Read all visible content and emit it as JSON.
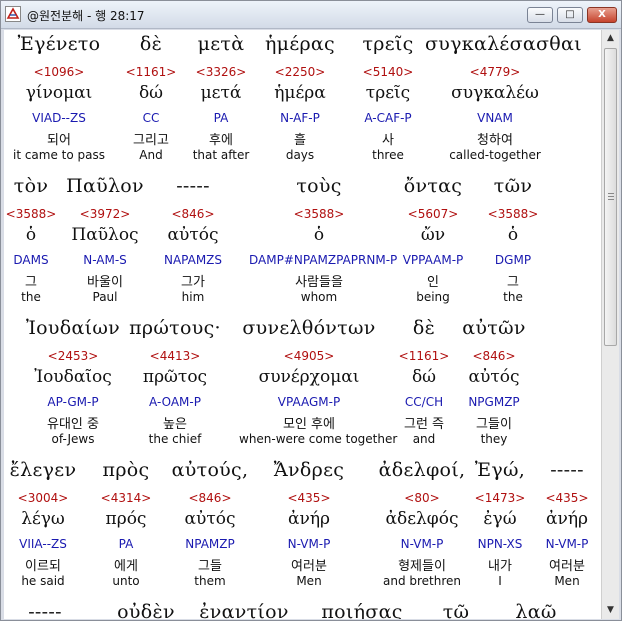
{
  "window": {
    "title": "@원전분해 - 행 28:17",
    "min_label": "—",
    "max_label": "□",
    "close_label": "X"
  },
  "rows": [
    {
      "words": [
        {
          "greek": "Ἐγένετο",
          "strong": "<1096>",
          "lemma": "γίνομαι",
          "parse": "VIAD--ZS",
          "korean": "되어",
          "english": "it came to pass"
        },
        {
          "greek": "δὲ",
          "strong": "<1161>",
          "lemma": "δώ",
          "parse": "CC",
          "korean": "그리고",
          "english": "And"
        },
        {
          "greek": "μετὰ",
          "strong": "<3326>",
          "lemma": "μετά",
          "parse": "PA",
          "korean": "후에",
          "english": "that after"
        },
        {
          "greek": "ἡμέρας",
          "strong": "<2250>",
          "lemma": "ἡμέρα",
          "parse": "N-AF-P",
          "korean": "흘",
          "english": "days"
        },
        {
          "greek": "τρεῖς",
          "strong": "<5140>",
          "lemma": "τρεῖς",
          "parse": "A-CAF-P",
          "korean": "사",
          "english": "three"
        },
        {
          "greek": "συγκαλέσασθαι",
          "strong": "<4779>",
          "lemma": "συγκαλέω",
          "parse": "VNAM",
          "korean": "청하여",
          "english": "called-together"
        }
      ]
    },
    {
      "words": [
        {
          "greek": "τὸν",
          "strong": "<3588>",
          "lemma": "ὁ",
          "parse": "DAMS",
          "korean": "그",
          "english": "the"
        },
        {
          "greek": "Παῦλον",
          "strong": "<3972>",
          "lemma": "Παῦλος",
          "parse": "N-AM-S",
          "korean": "바울이",
          "english": "Paul"
        },
        {
          "greek": "-----",
          "strong": "<846>",
          "lemma": "αὐτός",
          "parse": "NAPAMZS",
          "korean": "그가",
          "english": "him"
        },
        {
          "greek": "τοὺς",
          "strong": "<3588>",
          "lemma": "ὁ",
          "parse": "DAMP#NPAMZPAPRNM-P",
          "korean": "사람들을",
          "english": "whom"
        },
        {
          "greek": "ὄντας",
          "strong": "<5607>",
          "lemma": "ὤν",
          "parse": "VPPAAM-P",
          "korean": "인",
          "english": "being"
        },
        {
          "greek": "τῶν",
          "strong": "<3588>",
          "lemma": "ὁ",
          "parse": "DGMP",
          "korean": "그",
          "english": "the"
        }
      ]
    },
    {
      "words": [
        {
          "greek": "Ἰουδαίων",
          "strong": "<2453>",
          "lemma": "Ἰουδαῖος",
          "parse": "AP-GM-P",
          "korean": "유대인 중",
          "english": "of-Jews"
        },
        {
          "greek": "πρώτους·",
          "strong": "<4413>",
          "lemma": "πρῶτος",
          "parse": "A-OAM-P",
          "korean": "높은",
          "english": "the chief"
        },
        {
          "greek": "συνελθόντων",
          "strong": "<4905>",
          "lemma": "συνέρχομαι",
          "parse": "VPAAGM-P",
          "korean": "모인 후에",
          "english": "when-were come together"
        },
        {
          "greek": "δὲ",
          "strong": "<1161>",
          "lemma": "δώ",
          "parse": "CC/CH",
          "korean": "그런 즉",
          "english": "and"
        },
        {
          "greek": "αὐτῶν",
          "strong": "<846>",
          "lemma": "αὐτός",
          "parse": "NPGMZP",
          "korean": "그들이",
          "english": "they"
        }
      ]
    },
    {
      "words": [
        {
          "greek": "ἔλεγεν",
          "strong": "<3004>",
          "lemma": "λέγω",
          "parse": "VIIA--ZS",
          "korean": "이르되",
          "english": "he said"
        },
        {
          "greek": "πρὸς",
          "strong": "<4314>",
          "lemma": "πρός",
          "parse": "PA",
          "korean": "에게",
          "english": "unto"
        },
        {
          "greek": "αὐτούς,",
          "strong": "<846>",
          "lemma": "αὐτός",
          "parse": "NPAMZP",
          "korean": "그들",
          "english": "them"
        },
        {
          "greek": "Ἄνδρες",
          "strong": "<435>",
          "lemma": "ἀνήρ",
          "parse": "N-VM-P",
          "korean": "여러분",
          "english": "Men"
        },
        {
          "greek": "ἀδελφοί,",
          "strong": "<80>",
          "lemma": "ἀδελφός",
          "parse": "N-VM-P",
          "korean": "형제들이",
          "english": "and brethren"
        },
        {
          "greek": "Ἐγώ,",
          "strong": "<1473>",
          "lemma": "ἐγώ",
          "parse": "NPN-XS",
          "korean": "내가",
          "english": "I"
        },
        {
          "greek": "-----",
          "strong": "<435>",
          "lemma": "ἀνήρ",
          "parse": "N-VM-P",
          "korean": "여러분",
          "english": "Men"
        }
      ]
    },
    {
      "words": [
        {
          "greek": "-----"
        },
        {
          "greek": "οὐδὲν"
        },
        {
          "greek": "ἐναντίον"
        },
        {
          "greek": "ποιήσας"
        },
        {
          "greek": "τῷ"
        },
        {
          "greek": "λαῷ"
        }
      ]
    }
  ]
}
